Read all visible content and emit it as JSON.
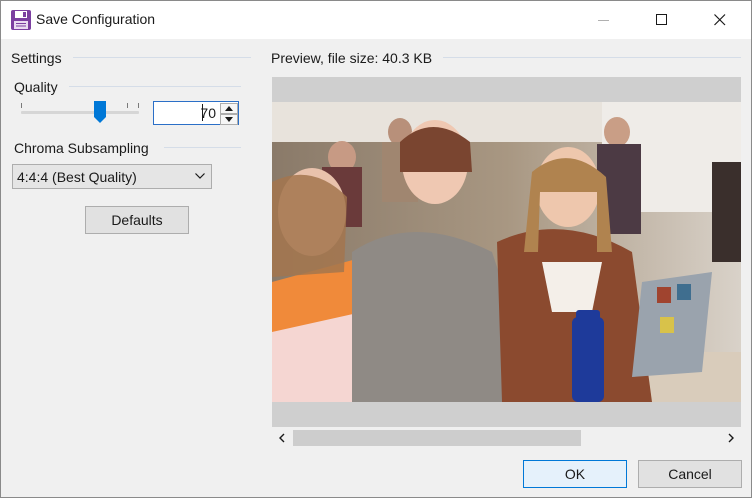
{
  "window": {
    "title": "Save Configuration",
    "icon": "floppy-disk-icon"
  },
  "settings": {
    "group_label": "Settings",
    "quality": {
      "label": "Quality",
      "value": "70",
      "slider_fraction": 0.7
    },
    "chroma": {
      "label": "Chroma Subsampling",
      "selected": "4:4:4 (Best Quality)"
    },
    "defaults_button": "Defaults"
  },
  "preview": {
    "label": "Preview, file size: 40.3 KB",
    "image_description_name": "preview-photo"
  },
  "footer": {
    "ok_label": "OK",
    "cancel_label": "Cancel"
  },
  "colors": {
    "accent": "#0078d7",
    "title_bg": "#ffffff",
    "dialog_bg": "#f0f0f0"
  }
}
